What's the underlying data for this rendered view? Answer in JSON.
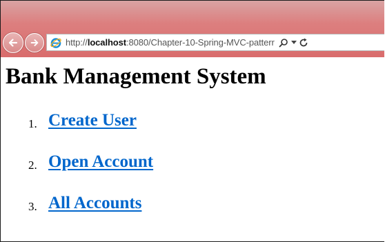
{
  "browser": {
    "url_prefix": "http://",
    "url_host": "localhost",
    "url_rest": ":8080/Chapter-10-Spring-MVC-patterr",
    "icons": {
      "back": "back-arrow-icon",
      "forward": "forward-arrow-icon",
      "site": "internet-explorer-icon",
      "search": "search-icon",
      "dropdown": "chevron-down-icon",
      "refresh": "refresh-icon"
    },
    "bar_color": "#dc7f7f"
  },
  "page": {
    "title": "Bank Management System",
    "link_color": "#0066cc",
    "menu": [
      {
        "number": "1.",
        "label": "Create User"
      },
      {
        "number": "2.",
        "label": "Open Account"
      },
      {
        "number": "3.",
        "label": "All Accounts"
      }
    ]
  }
}
